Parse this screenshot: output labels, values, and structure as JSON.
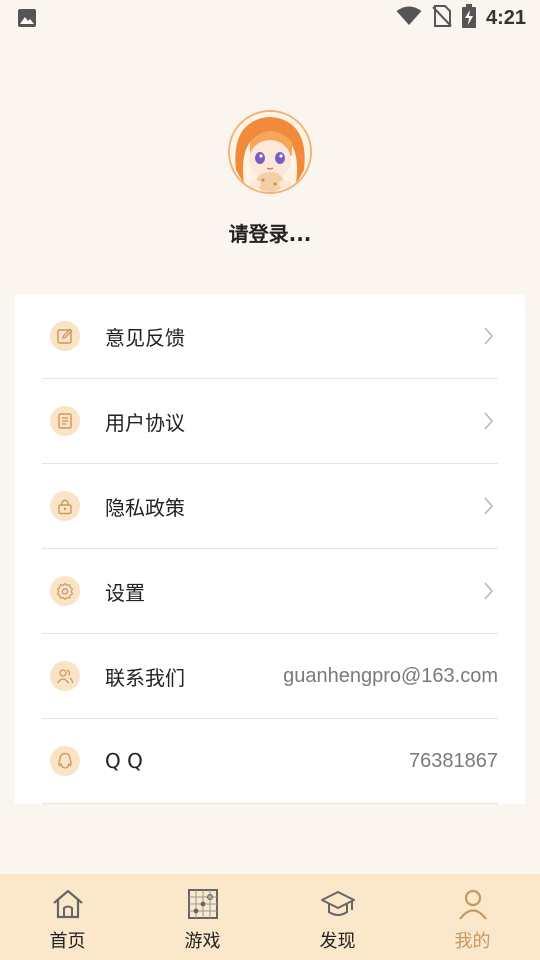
{
  "status_bar": {
    "time": "4:21",
    "icons": [
      "image-notification-icon",
      "wifi-icon",
      "no-sim-icon",
      "battery-charging-icon"
    ]
  },
  "profile": {
    "login_prompt": "请登录..."
  },
  "menu": {
    "items": [
      {
        "label": "意见反馈",
        "icon": "feedback-icon"
      },
      {
        "label": "用户协议",
        "icon": "agreement-icon"
      },
      {
        "label": "隐私政策",
        "icon": "lock-icon"
      },
      {
        "label": "设置",
        "icon": "gear-icon"
      },
      {
        "label": "联系我们",
        "icon": "contacts-icon",
        "value": "guanhengpro@163.com"
      },
      {
        "label": "Q Q",
        "icon": "qq-icon",
        "value": "76381867"
      }
    ]
  },
  "tabbar": {
    "tabs": [
      {
        "label": "首页",
        "icon": "home-icon"
      },
      {
        "label": "游戏",
        "icon": "board-game-icon"
      },
      {
        "label": "发现",
        "icon": "graduation-cap-icon"
      },
      {
        "label": "我的",
        "icon": "person-icon",
        "active": true
      }
    ]
  },
  "colors": {
    "background": "#faf5ee",
    "card": "#ffffff",
    "icon_circle": "#fbe3c6",
    "icon_stroke": "#c89863",
    "tabbar": "#fbe8cb",
    "active_tab": "#c89863"
  }
}
